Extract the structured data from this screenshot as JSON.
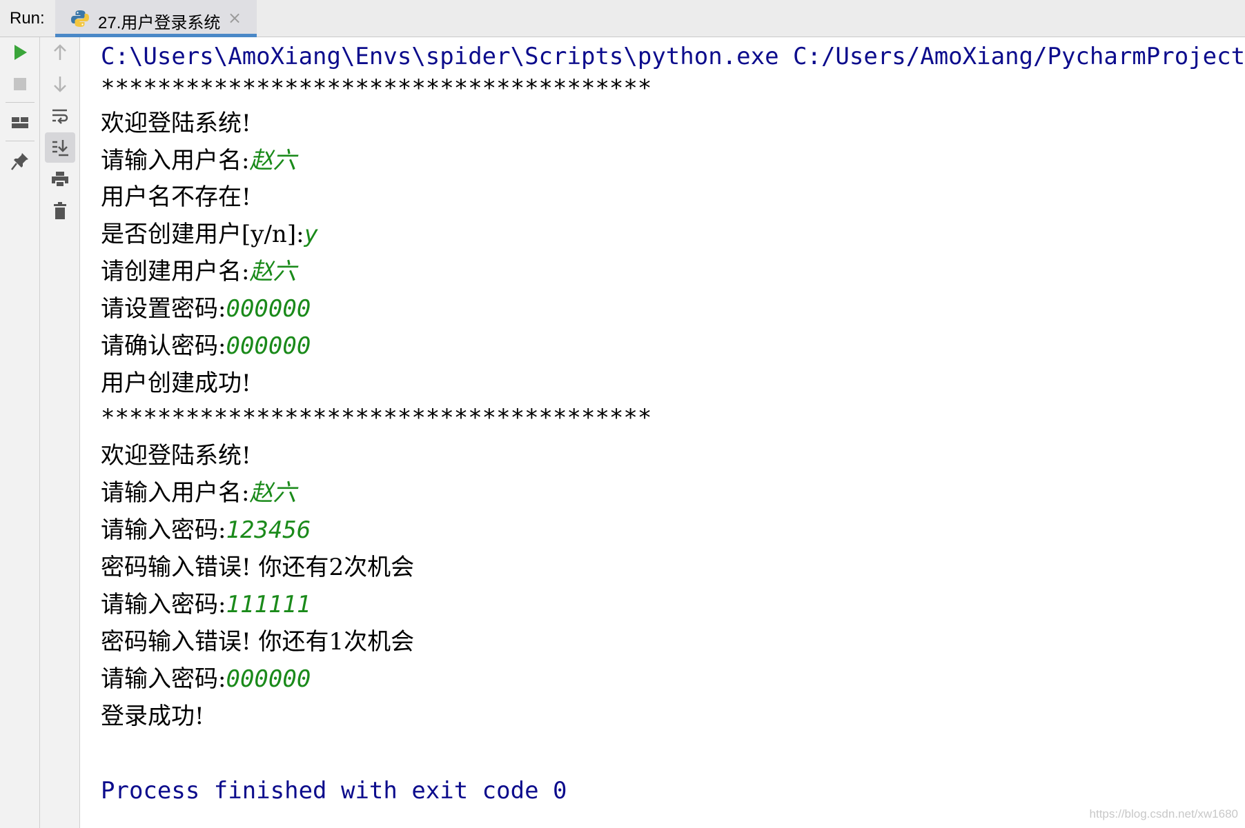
{
  "run_panel": {
    "label": "Run:",
    "tab": {
      "title": "27.用户登录系统",
      "close": "×",
      "icon": "python-icon"
    }
  },
  "toolbar": {
    "left": [
      "run-icon",
      "stop-icon",
      "layout-icon",
      "pin-icon"
    ],
    "right": [
      "arrow-up-icon",
      "arrow-down-icon",
      "soft-wrap-icon",
      "scroll-to-end-icon",
      "print-icon",
      "trash-icon"
    ]
  },
  "console": {
    "command": "C:\\Users\\AmoXiang\\Envs\\spider\\Scripts\\python.exe C:/Users/AmoXiang/PycharmProjects/",
    "separator1": "***************************************",
    "welcome1": "欢迎登陆系统!",
    "prompt_username1": "请输入用户名:",
    "input_username1": "赵六",
    "user_not_exist": "用户名不存在!",
    "prompt_create": "是否创建用户[y/n]:",
    "input_create": "y",
    "prompt_create_username": "请创建用户名:",
    "input_create_username": "赵六",
    "prompt_set_password": "请设置密码:",
    "input_set_password": "000000",
    "prompt_confirm_password": "请确认密码:",
    "input_confirm_password": "000000",
    "create_success": "用户创建成功!",
    "separator2": "***************************************",
    "welcome2": "欢迎登陆系统!",
    "prompt_username2": "请输入用户名:",
    "input_username2": "赵六",
    "prompt_password1": "请输入密码:",
    "input_password1": "123456",
    "error1": "密码输入错误! 你还有2次机会",
    "prompt_password2": "请输入密码:",
    "input_password2": "111111",
    "error2": "密码输入错误! 你还有1次机会",
    "prompt_password3": "请输入密码:",
    "input_password3": "000000",
    "login_success": "登录成功!",
    "exit_message": "Process finished with exit code 0"
  },
  "watermark": "https://blog.csdn.net/xw1680",
  "colors": {
    "system_text": "#0c0c8c",
    "user_input": "#1a8a1a",
    "run_green": "#3aa53a",
    "tab_underline": "#4a88c7"
  }
}
